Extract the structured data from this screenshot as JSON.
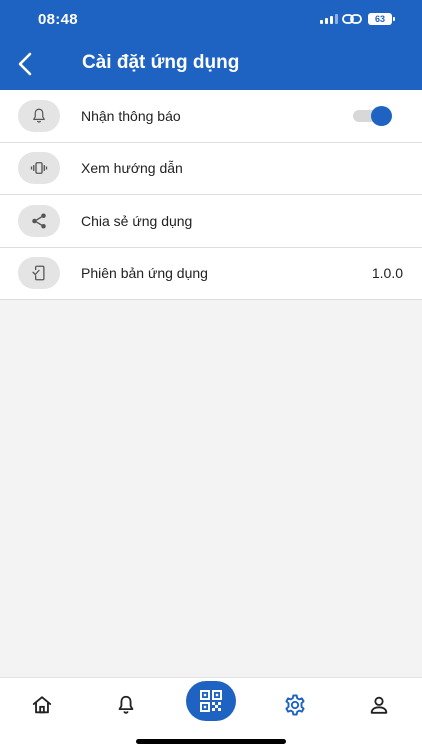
{
  "status_bar": {
    "time": "08:48",
    "battery": "63"
  },
  "header": {
    "title": "Cài đặt ứng dụng"
  },
  "settings": {
    "items": [
      {
        "label": "Nhận thông báo",
        "icon": "bell-icon",
        "toggle_on": true
      },
      {
        "label": "Xem hướng dẫn",
        "icon": "vibrate-icon"
      },
      {
        "label": "Chia sẻ ứng dụng",
        "icon": "share-icon"
      },
      {
        "label": "Phiên bản ứng dụng",
        "icon": "phone-check-icon",
        "value": "1.0.0"
      }
    ]
  },
  "bottom_nav": {
    "items": [
      "home-icon",
      "bell-icon",
      "qr-code-icon",
      "gear-icon",
      "user-icon"
    ],
    "active": "gear-icon"
  },
  "colors": {
    "primary": "#1f63c2",
    "background": "#f3f3f3",
    "icon_gray": "#444444"
  }
}
